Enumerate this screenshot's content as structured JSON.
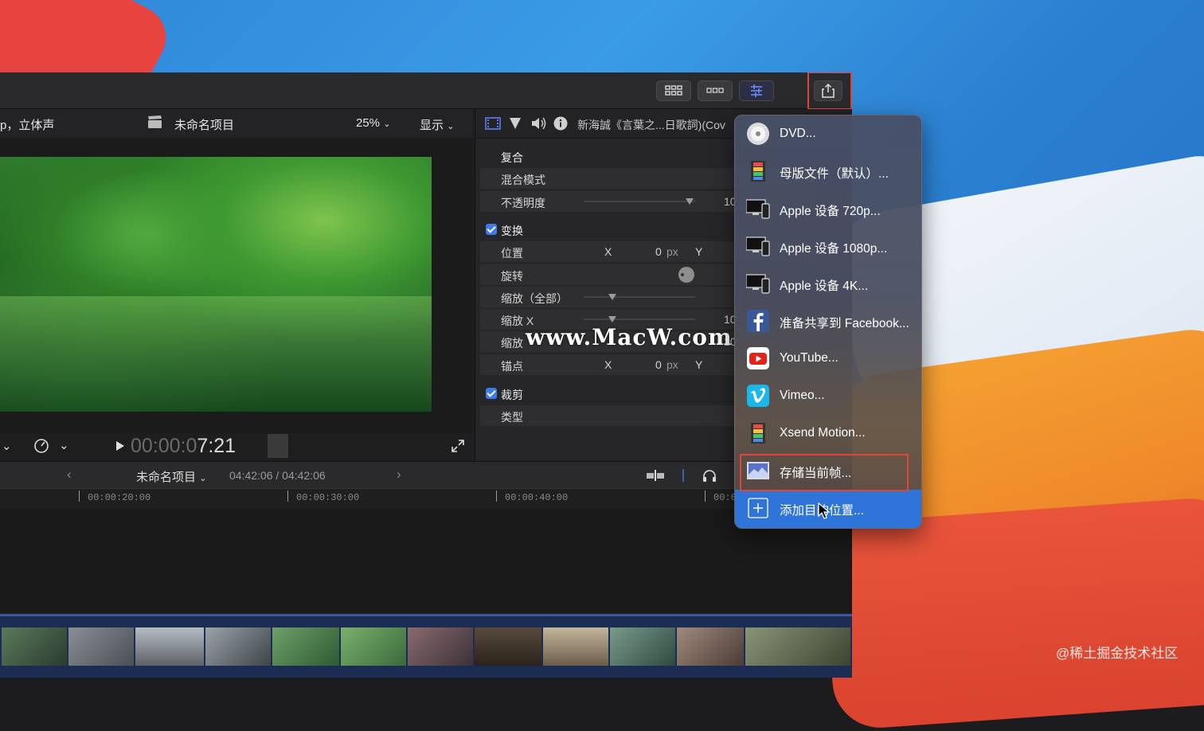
{
  "viewer": {
    "format_label": "p，立体声",
    "project_name": "未命名项目",
    "zoom": "25%",
    "view_menu": "显示",
    "timecode_dim": "00:00:0",
    "timecode_bright": "7:21"
  },
  "inspector": {
    "clip_title": "新海誠《言葉之...日歌詞)(Cov",
    "sections": {
      "composite": "复合",
      "blend_mode": "混合模式",
      "opacity": "不透明度",
      "opacity_value": "10",
      "transform": "变换",
      "position": "位置",
      "position_x_label": "X",
      "position_x_value": "0",
      "position_unit": "px",
      "position_y_label": "Y",
      "rotation": "旋转",
      "scale_all": "缩放（全部）",
      "scale_x": "缩放 X",
      "scale_x_value": "10",
      "scale_y": "缩放",
      "scale_y_value": "10",
      "anchor": "锚点",
      "anchor_x_label": "X",
      "anchor_x_value": "0",
      "anchor_unit": "px",
      "anchor_y_label": "Y",
      "crop": "裁剪",
      "type": "类型"
    }
  },
  "timeline": {
    "project_name": "未命名项目",
    "duration": "04:42:06 / 04:42:06",
    "ruler": [
      "00:00:20:00",
      "00:00:30:00",
      "00:00:40:00",
      "00:0"
    ]
  },
  "share_menu": {
    "items": [
      {
        "label": "DVD...",
        "icon": "dvd-icon"
      },
      {
        "label": "母版文件（默认）...",
        "icon": "master-file-icon"
      },
      {
        "label": "Apple 设备 720p...",
        "icon": "apple-devices-icon"
      },
      {
        "label": "Apple 设备 1080p...",
        "icon": "apple-devices-icon"
      },
      {
        "label": "Apple 设备 4K...",
        "icon": "apple-devices-icon"
      },
      {
        "label": "准备共享到 Facebook...",
        "icon": "facebook-icon"
      },
      {
        "label": "YouTube...",
        "icon": "youtube-icon"
      },
      {
        "label": "Vimeo...",
        "icon": "vimeo-icon"
      },
      {
        "label": "Xsend Motion...",
        "icon": "xsend-motion-icon"
      },
      {
        "label": "存储当前帧...",
        "icon": "save-frame-icon"
      },
      {
        "label": "添加目的位置...",
        "icon": "add-destination-icon"
      }
    ]
  },
  "overlay": {
    "watermark": "www.MacW.com",
    "credit": "@稀土掘金技术社区"
  },
  "colors": {
    "accent": "#2f74d8",
    "highlight": "#e0453a"
  }
}
